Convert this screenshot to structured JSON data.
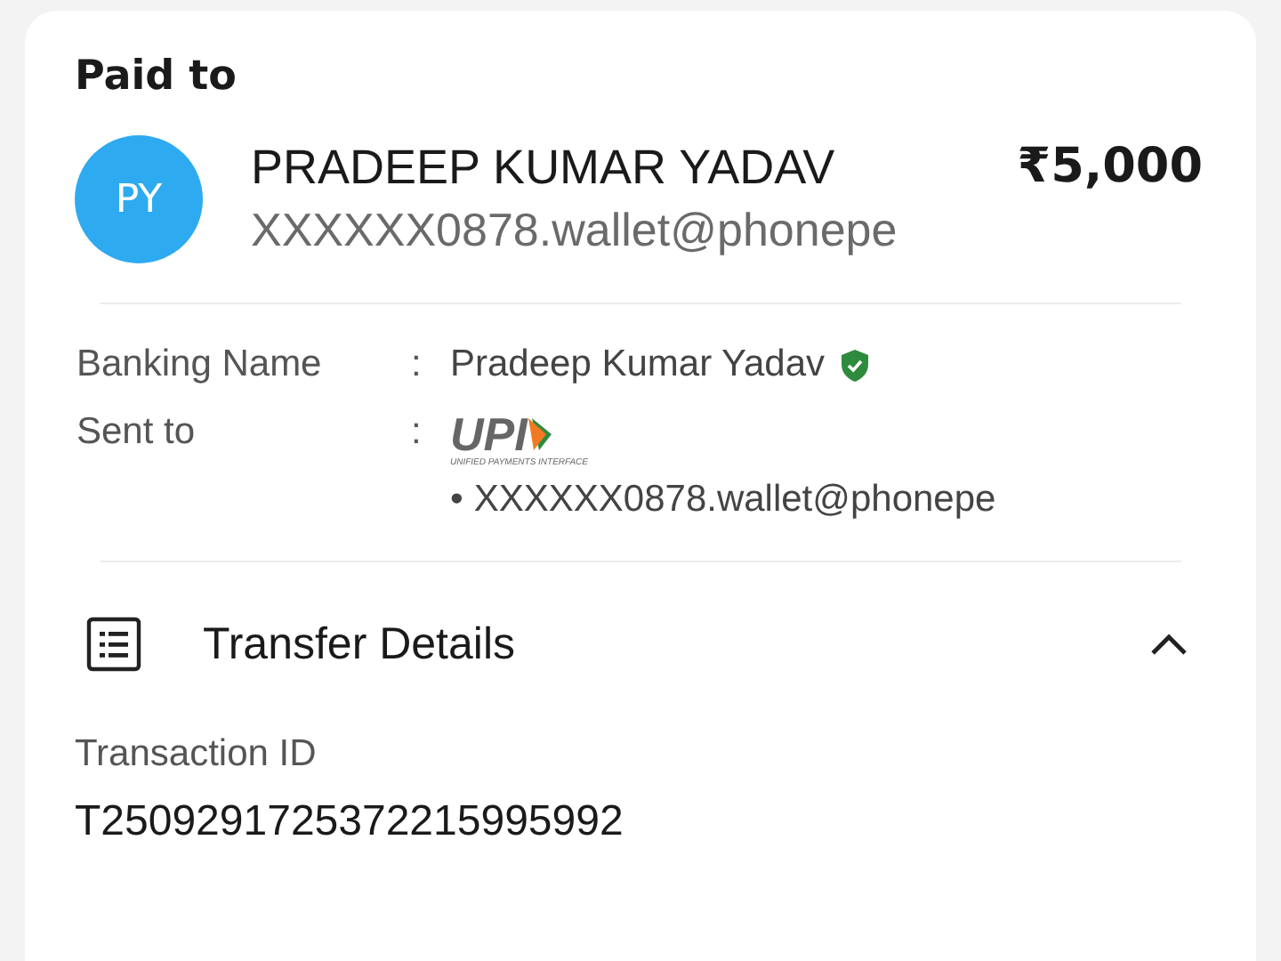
{
  "section_title": "Paid to",
  "payee": {
    "initials": "PY",
    "name": "PRADEEP KUMAR YADAV",
    "upi_id": "XXXXXX0878.wallet@phonepe",
    "amount": "₹5,000"
  },
  "details": [
    {
      "kind": "verified",
      "label": "Banking Name",
      "separator": ":",
      "value": "Pradeep Kumar Yadav",
      "verified": true
    },
    {
      "kind": "upi",
      "label": "Sent to",
      "separator": ":",
      "logo_text": "UPI",
      "logo_tagline": "UNIFIED PAYMENTS INTERFACE",
      "bullet": "•",
      "value": "XXXXXX0878.wallet@phonepe"
    }
  ],
  "transfer_details": {
    "title": "Transfer Details",
    "expanded": true,
    "fields": [
      {
        "label": "Transaction ID",
        "value": "T2509291725372215995992"
      }
    ]
  }
}
